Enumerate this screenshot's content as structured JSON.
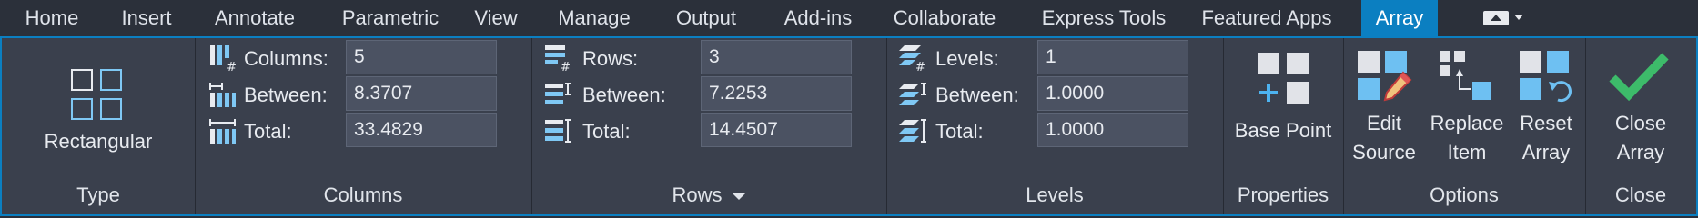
{
  "tabs": [
    {
      "label": "Home"
    },
    {
      "label": "Insert"
    },
    {
      "label": "Annotate"
    },
    {
      "label": "Parametric"
    },
    {
      "label": "View"
    },
    {
      "label": "Manage"
    },
    {
      "label": "Output"
    },
    {
      "label": "Add-ins"
    },
    {
      "label": "Collaborate"
    },
    {
      "label": "Express Tools"
    },
    {
      "label": "Featured Apps"
    },
    {
      "label": "Array"
    }
  ],
  "active_tab": "Array",
  "accent_color": "#0b7fc1",
  "panels": {
    "type": {
      "title": "Type",
      "button_label": "Rectangular",
      "icon": "rectangular-array-icon"
    },
    "columns": {
      "title": "Columns",
      "rows": [
        {
          "label": "Columns:",
          "value": "5",
          "icon": "columns-count-icon"
        },
        {
          "label": "Between:",
          "value": "8.3707",
          "icon": "column-spacing-icon"
        },
        {
          "label": "Total:",
          "value": "33.4829",
          "icon": "column-total-icon"
        }
      ]
    },
    "rows": {
      "title": "Rows",
      "rows": [
        {
          "label": "Rows:",
          "value": "3",
          "icon": "rows-count-icon"
        },
        {
          "label": "Between:",
          "value": "7.2253",
          "icon": "row-spacing-icon"
        },
        {
          "label": "Total:",
          "value": "14.4507",
          "icon": "row-total-icon"
        }
      ]
    },
    "levels": {
      "title": "Levels",
      "rows": [
        {
          "label": "Levels:",
          "value": "1",
          "icon": "levels-count-icon"
        },
        {
          "label": "Between:",
          "value": "1.0000",
          "icon": "level-spacing-icon"
        },
        {
          "label": "Total:",
          "value": "1.0000",
          "icon": "level-total-icon"
        }
      ]
    },
    "properties": {
      "title": "Properties",
      "base_point_label": "Base Point"
    },
    "options": {
      "title": "Options",
      "edit_source": {
        "line1": "Edit",
        "line2": "Source"
      },
      "replace_item": {
        "line1": "Replace",
        "line2": "Item"
      },
      "reset_array": {
        "line1": "Reset",
        "line2": "Array"
      }
    },
    "close": {
      "title": "Close",
      "close_array": {
        "line1": "Close",
        "line2": "Array"
      }
    }
  }
}
